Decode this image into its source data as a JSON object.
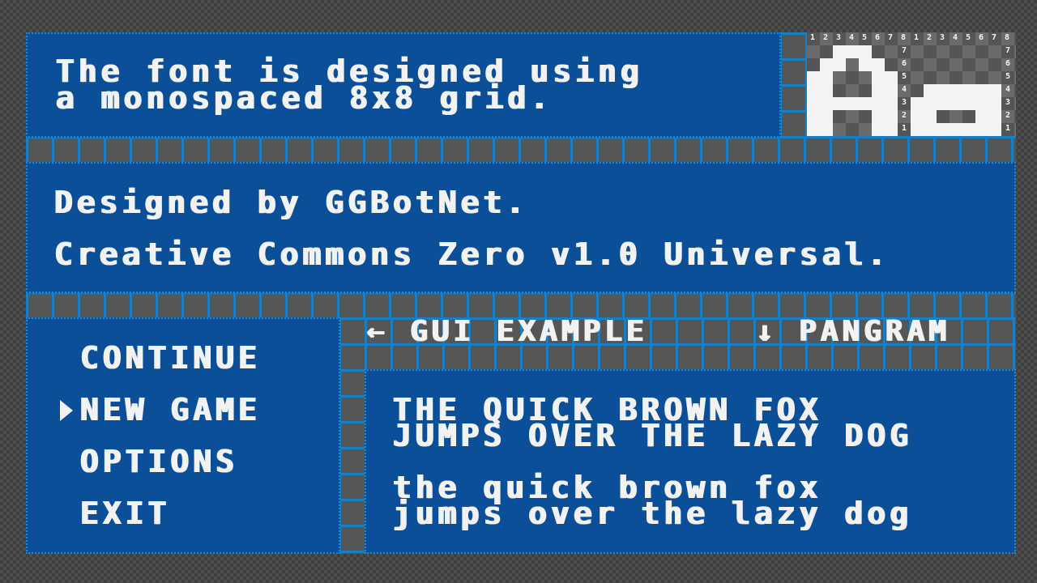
{
  "intro": {
    "line1": "The font is designed using",
    "line2": "a monospaced 8x8 grid."
  },
  "credits": {
    "author": "Designed by GGBotNet.",
    "license": "Creative Commons Zero v1.0 Universal."
  },
  "menu": {
    "items": [
      {
        "label": "CONTINUE",
        "selected": false
      },
      {
        "label": "NEW GAME",
        "selected": true
      },
      {
        "label": "OPTIONS",
        "selected": false
      },
      {
        "label": "EXIT",
        "selected": false
      }
    ]
  },
  "nav": {
    "gui_example": "← GUI EXAMPLE",
    "pangram": "↓ PANGRAM"
  },
  "pangram": {
    "upper1": "THE QUICK BROWN FOX",
    "upper2": "JUMPS OVER THE LAZY DOG",
    "lower1": "the quick brown fox",
    "lower2": "jumps over the lazy dog"
  },
  "glyph_demo": {
    "glyphs": "Aa",
    "column_numbers": [
      "1",
      "2",
      "3",
      "4",
      "5",
      "6",
      "7",
      "8",
      "1",
      "2",
      "3",
      "4",
      "5",
      "6",
      "7",
      "8"
    ],
    "row_numbers": [
      "8",
      "7",
      "6",
      "5",
      "4",
      "3",
      "2",
      "1"
    ]
  },
  "colors": {
    "panel": "#0b4f98",
    "grid_line": "#1a7ec4",
    "text": "#f2f2f2",
    "background": "#4e4e4e"
  }
}
